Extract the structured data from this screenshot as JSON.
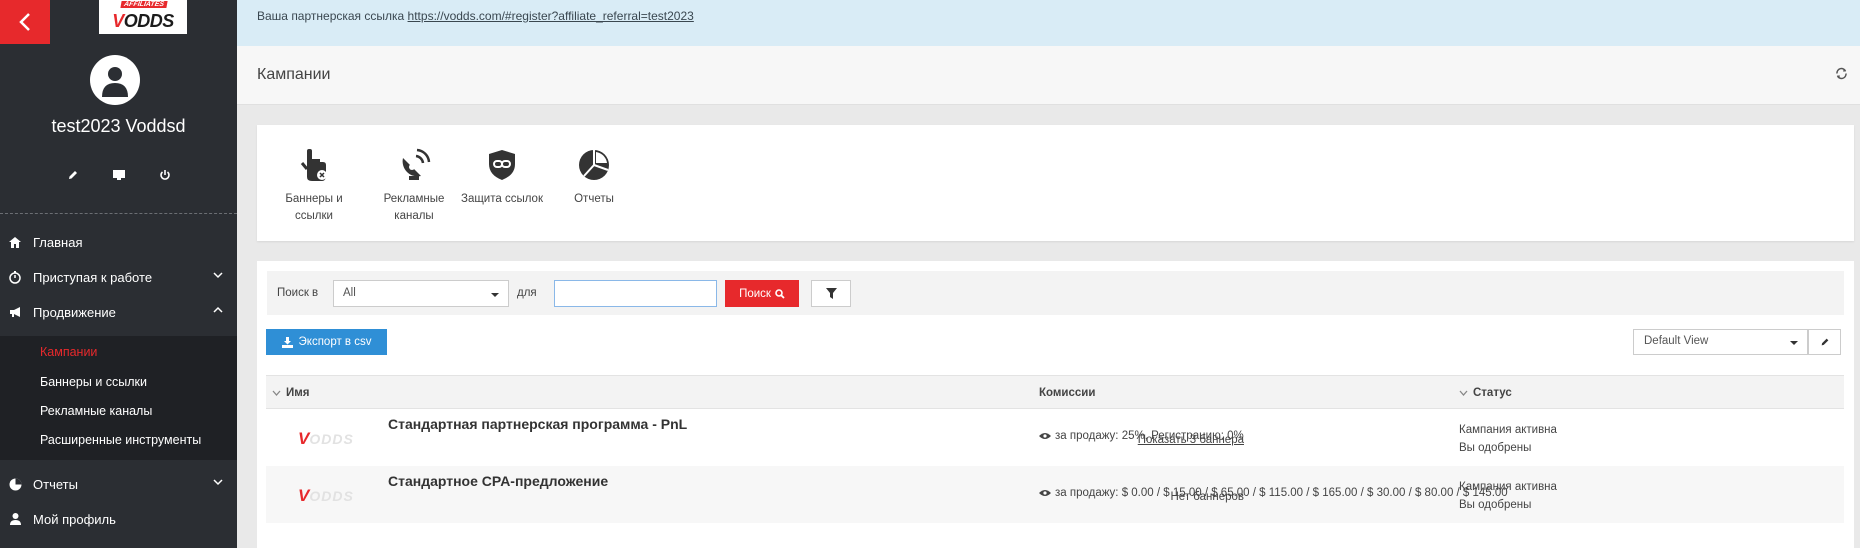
{
  "sidebar": {
    "logo": {
      "top": "AFFILIATES",
      "main_red": "V",
      "main_dark": "ODDS"
    },
    "username": "test2023 Voddsd",
    "nav": [
      {
        "label": "Главная",
        "icon": "home-icon"
      },
      {
        "label": "Приступая к работе",
        "icon": "timer-icon",
        "chevron": "down"
      },
      {
        "label": "Продвижение",
        "icon": "megaphone-icon",
        "chevron": "up"
      },
      {
        "label": "Отчеты",
        "icon": "pie-icon",
        "chevron": "down"
      },
      {
        "label": "Мой профиль",
        "icon": "user-icon"
      }
    ],
    "submenu": [
      {
        "label": "Кампании",
        "active": true
      },
      {
        "label": "Баннеры и ссылки"
      },
      {
        "label": "Рекламные каналы"
      },
      {
        "label": "Расширенные инструменты"
      }
    ]
  },
  "topbar": {
    "prefix": "Ваша партнерская ссылка",
    "link": "https://vodds.com/#register?affiliate_referral=test2023"
  },
  "page": {
    "title": "Кампании"
  },
  "quick_links": [
    {
      "label": "Баннеры и ссылки",
      "icon": "hand-click-icon"
    },
    {
      "label": "Рекламные каналы",
      "icon": "satellite-dish-icon"
    },
    {
      "label": "Защита ссылок",
      "icon": "link-shield-icon"
    },
    {
      "label": "Отчеты",
      "icon": "pie-chart-icon"
    }
  ],
  "search": {
    "label_in": "Поиск в",
    "select_value": "All",
    "label_for": "для",
    "input_value": "",
    "button": "Поиск"
  },
  "export_button": "Экспорт в csv",
  "view_select": "Default View",
  "table": {
    "headers": {
      "name": "Имя",
      "commissions": "Комиссии",
      "status": "Статус"
    },
    "rows": [
      {
        "name": "Стандартная партнерская программа - PnL",
        "banners": "Показать 3 баннера",
        "banners_link": true,
        "commission": "за продажу: 25%, Регистрацию: 0%",
        "status_1": "Кампания активна",
        "status_2": "Вы одобрены"
      },
      {
        "name": "Стандартное CPA-предложение",
        "banners": "Нет баннеров",
        "banners_link": false,
        "commission": "за продажу: $ 0.00 / $ 15.00 / $ 65.00 / $ 115.00 / $ 165.00 / $ 30.00 / $ 80.00 / $ 145.00",
        "status_1": "Кампания активна",
        "status_2": "Вы одобрены"
      }
    ]
  },
  "colors": {
    "accent": "#e7292c",
    "primary": "#2f8fd6",
    "sidebar": "#2b2e33"
  }
}
